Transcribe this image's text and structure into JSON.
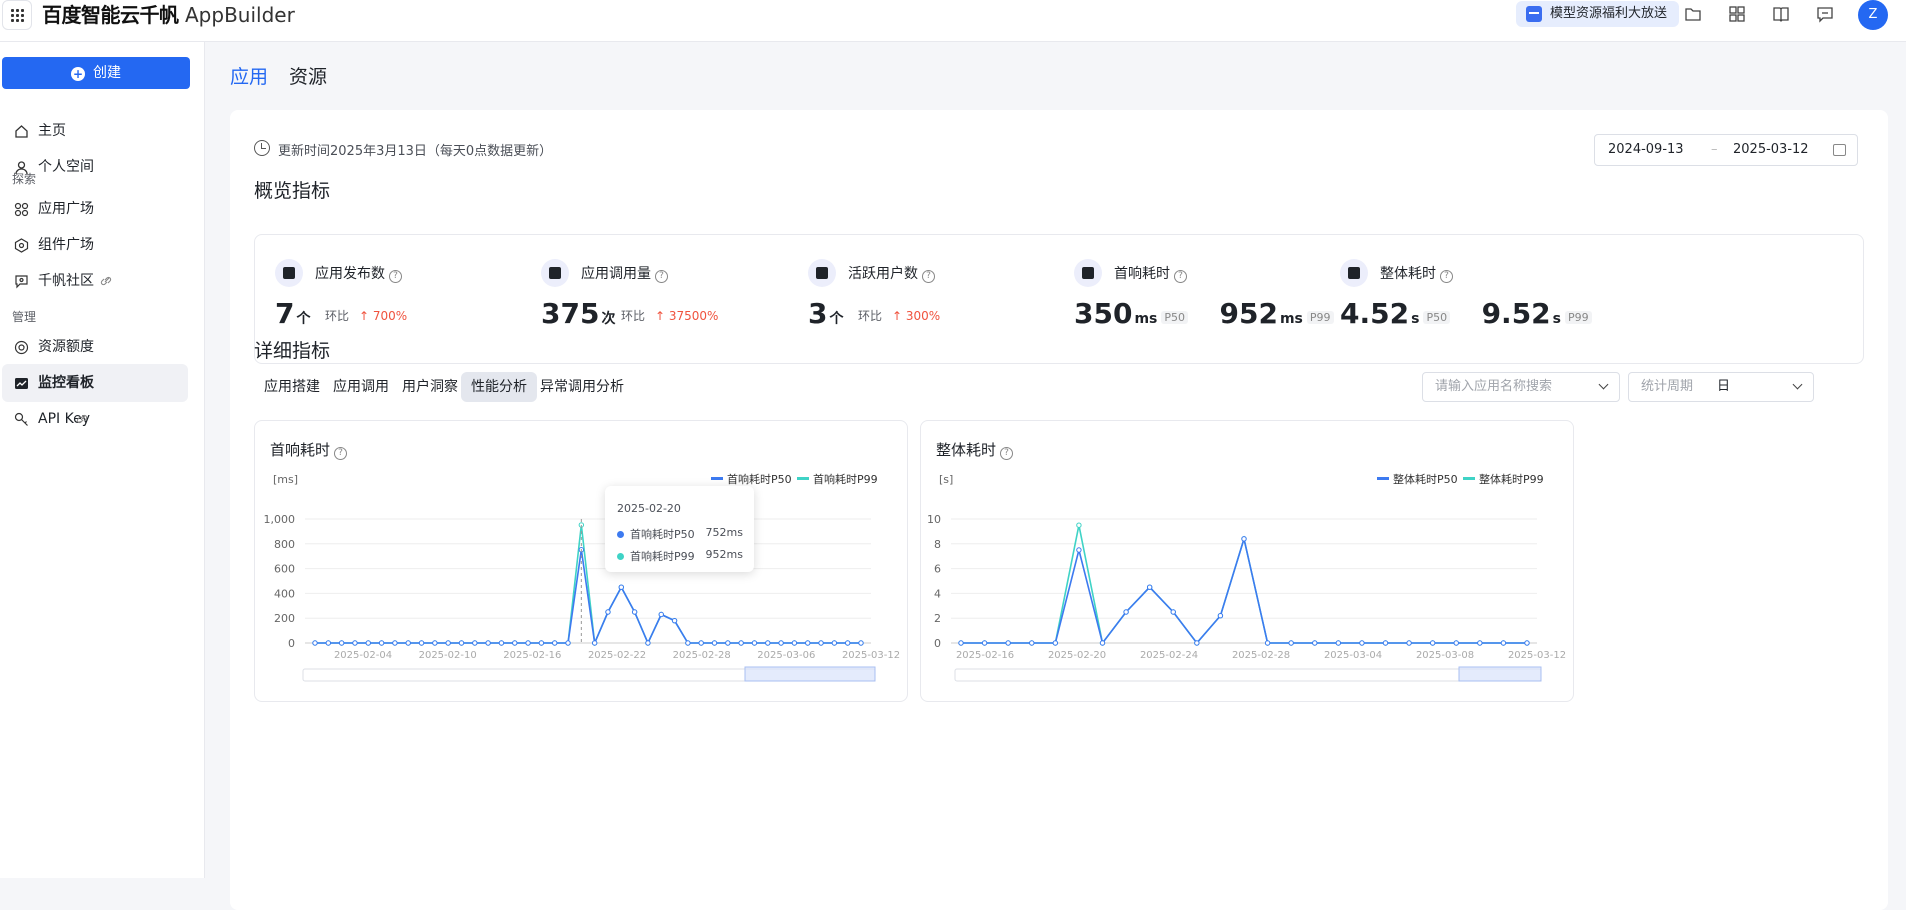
{
  "app": {
    "brand_cn": "百度智能云千帆",
    "brand_en": "AppBuilder",
    "promo": "模型资源福利大放送",
    "avatar": "Z"
  },
  "sidebar": {
    "create_label": "创建",
    "items_top": [
      {
        "label": "主页",
        "icon": "home-icon"
      },
      {
        "label": "个人空间",
        "icon": "user-icon"
      }
    ],
    "group_explore": "探索",
    "items_explore": [
      {
        "label": "应用广场",
        "icon": "apps-icon"
      },
      {
        "label": "组件广场",
        "icon": "component-icon"
      },
      {
        "label": "千帆社区",
        "icon": "community-icon"
      }
    ],
    "group_manage": "管理",
    "items_manage": [
      {
        "label": "资源额度",
        "icon": "quota-icon"
      },
      {
        "label": "监控看板",
        "icon": "chart-icon",
        "active": true
      },
      {
        "label": "API Key",
        "icon": "key-icon"
      }
    ]
  },
  "tabs": [
    "应用",
    "资源"
  ],
  "update_text": "更新时间2025年3月13日（每天0点数据更新）",
  "date_range": {
    "start": "2024-09-13",
    "sep": "–",
    "end": "2025-03-12"
  },
  "overview_title": "概览指标",
  "metrics": [
    {
      "label": "应用发布数",
      "value": "7",
      "unit": "个",
      "cmp_label": "环比",
      "cmp": "↑ 700%"
    },
    {
      "label": "应用调用量",
      "value": "375",
      "unit": "次",
      "cmp_label": "环比",
      "cmp": "↑ 37500%"
    },
    {
      "label": "活跃用户数",
      "value": "3",
      "unit": "个",
      "cmp_label": "环比",
      "cmp": "↑ 300%"
    },
    {
      "label": "首响耗时",
      "v1": "350",
      "u1": "ms",
      "t1": "P50",
      "v2": "952",
      "u2": "ms",
      "t2": "P99"
    },
    {
      "label": "整体耗时",
      "v1": "4.52",
      "u1": "s",
      "t1": "P50",
      "v2": "9.52",
      "u2": "s",
      "t2": "P99"
    }
  ],
  "detail_title": "详细指标",
  "subtabs": [
    "应用搭建",
    "应用调用",
    "用户洞察",
    "性能分析",
    "异常调用分析"
  ],
  "search_placeholder": "请输入应用名称搜索",
  "period": {
    "label": "统计周期",
    "value": "日"
  },
  "tooltip": {
    "date": "2025-02-20",
    "p50_label": "首响耗时P50",
    "p50_value": "752ms",
    "p99_label": "首响耗时P99",
    "p99_value": "952ms"
  },
  "chart_data": [
    {
      "type": "line",
      "title": "首响耗时",
      "ylabel": "[ms]",
      "ylim": [
        0,
        1000
      ],
      "yticks": [
        "1,000",
        "800",
        "600",
        "400",
        "200",
        "0"
      ],
      "xticks": [
        "2025-02-04",
        "2025-02-10",
        "2025-02-16",
        "2025-02-22",
        "2025-02-28",
        "2025-03-06",
        "2025-03-12"
      ],
      "series": [
        {
          "name": "首响耗时P50",
          "color": "#3d7af0",
          "values": [
            0,
            0,
            0,
            0,
            0,
            0,
            0,
            0,
            0,
            0,
            0,
            0,
            0,
            0,
            0,
            0,
            0,
            0,
            0,
            0,
            752,
            0,
            250,
            450,
            250,
            0,
            230,
            180,
            0,
            0,
            0,
            0,
            0,
            0,
            0,
            0,
            0,
            0,
            0,
            0,
            0,
            0
          ]
        },
        {
          "name": "首响耗时P99",
          "color": "#3fd3c6",
          "values": [
            0,
            0,
            0,
            0,
            0,
            0,
            0,
            0,
            0,
            0,
            0,
            0,
            0,
            0,
            0,
            0,
            0,
            0,
            0,
            0,
            952,
            0,
            250,
            450,
            250,
            0,
            230,
            180,
            0,
            0,
            0,
            0,
            0,
            0,
            0,
            0,
            0,
            0,
            0,
            0,
            0,
            0
          ]
        }
      ]
    },
    {
      "type": "line",
      "title": "整体耗时",
      "ylabel": "[s]",
      "ylim": [
        0,
        10
      ],
      "yticks": [
        "10",
        "8",
        "6",
        "4",
        "2",
        "0"
      ],
      "xticks": [
        "2025-02-16",
        "2025-02-20",
        "2025-02-24",
        "2025-02-28",
        "2025-03-04",
        "2025-03-08",
        "2025-03-12"
      ],
      "series": [
        {
          "name": "整体耗时P50",
          "color": "#3d7af0",
          "values": [
            0,
            0,
            0,
            0,
            0,
            7.5,
            0,
            2.5,
            4.5,
            2.5,
            0,
            2.2,
            8.4,
            0,
            0,
            0,
            0,
            0,
            0,
            0,
            0,
            0,
            0,
            0,
            0
          ]
        },
        {
          "name": "整体耗时P99",
          "color": "#3fd3c6",
          "values": [
            0,
            0,
            0,
            0,
            0,
            9.5,
            0,
            2.5,
            4.5,
            2.5,
            0,
            2.2,
            8.4,
            0,
            0,
            0,
            0,
            0,
            0,
            0,
            0,
            0,
            0,
            0,
            0
          ]
        }
      ]
    }
  ]
}
